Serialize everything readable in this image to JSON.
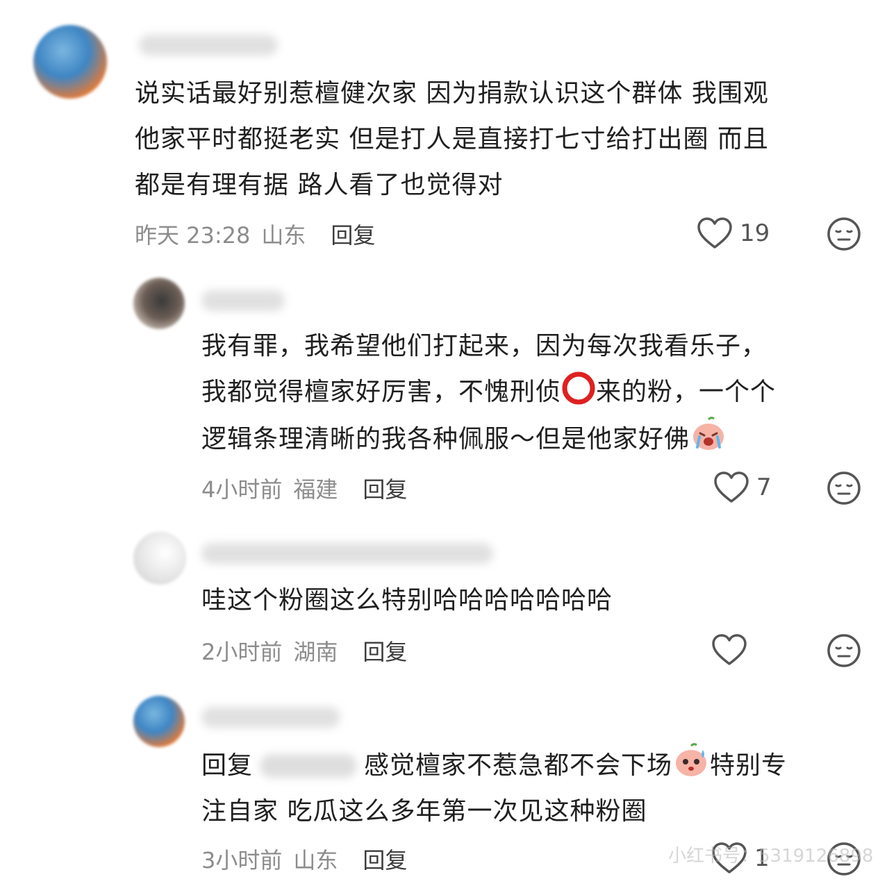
{
  "comments": [
    {
      "lines": [
        "说实话最好别惹檀健次家  因为捐款认识这个群体  我围观",
        "他家平时都挺老实  但是打人是直接打七寸给打出圈  而且",
        "都是有理有据  路人看了也觉得对"
      ],
      "time": "昨天 23:28",
      "location": "山东",
      "reply_label": "回复",
      "likes": "19"
    },
    {
      "lines": [
        "我有罪，我希望他们打起来，因为每次我看乐子，",
        "我都觉得檀家好厉害，不愧刑侦",
        "来的粉，一个个",
        "逻辑条理清晰的我各种佩服～但是他家好佛"
      ],
      "time": "4小时前",
      "location": "福建",
      "reply_label": "回复",
      "likes": "7"
    },
    {
      "lines": [
        "哇这个粉圈这么特别哈哈哈哈哈哈哈"
      ],
      "time": "2小时前",
      "location": "湖南",
      "reply_label": "回复",
      "likes": ""
    },
    {
      "reply_prefix": "回复",
      "lines": [
        "感觉檀家不惹急都不会下场",
        "特别专",
        "注自家  吃瓜这么多年第一次见这种粉圈"
      ],
      "time": "3小时前",
      "location": "山东",
      "reply_label": "回复",
      "likes": "1"
    }
  ],
  "watermark": "小红书号：5319126898",
  "icons": {
    "like": "heart-outline-icon",
    "dislike": "neutral-face-icon",
    "circle": "red-circle-emoji",
    "crying": "crying-peach-emoji",
    "sweat": "sweating-peach-emoji"
  },
  "colors": {
    "meta": "#8c8c8c",
    "text": "#1f1f1f",
    "circle": "#e02020"
  }
}
